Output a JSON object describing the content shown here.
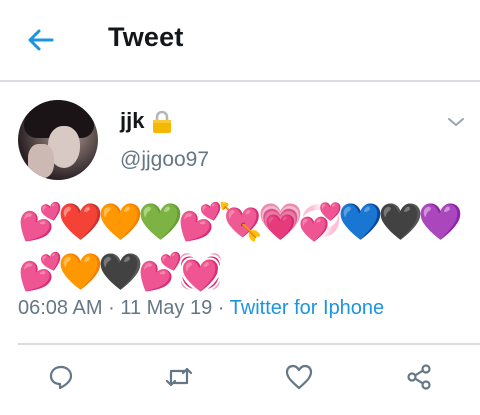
{
  "header": {
    "title": "Tweet",
    "back_icon": "arrow-left-icon"
  },
  "tweet": {
    "display_name": "jjk",
    "protected_icon": "lock-icon",
    "handle": "@jjgoo97",
    "emojis": [
      "💕",
      "❤️",
      "🧡",
      "💚",
      "💕",
      "💘",
      "💗",
      "💞",
      "💙",
      "🖤",
      "💜",
      "💕",
      "🧡",
      "🖤",
      "💕",
      "💓"
    ],
    "time": "06:08 AM",
    "separator": "·",
    "date": "11 May 19",
    "source": "Twitter for Iphone"
  },
  "actions": [
    {
      "name": "reply",
      "icon": "reply-icon"
    },
    {
      "name": "retweet",
      "icon": "retweet-icon"
    },
    {
      "name": "like",
      "icon": "heart-icon"
    },
    {
      "name": "share",
      "icon": "share-icon"
    }
  ],
  "colors": {
    "accent": "#1b95e0",
    "muted": "#657786",
    "divider": "#d9dde1",
    "lock": "#f5b800"
  }
}
